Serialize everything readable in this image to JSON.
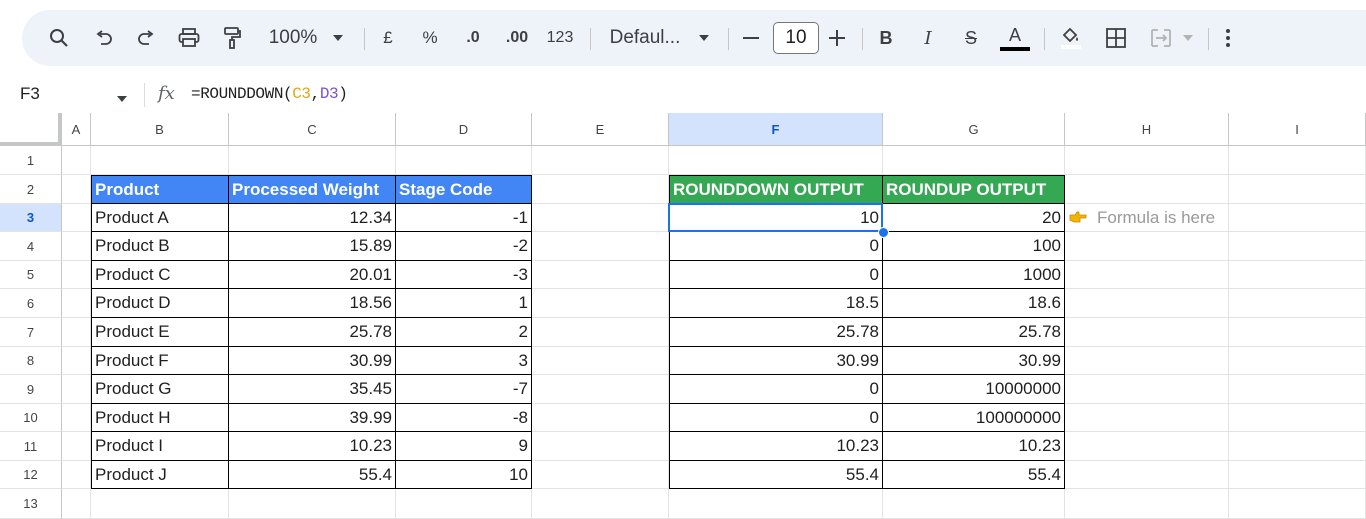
{
  "toolbar": {
    "zoom": "100%",
    "currency": "£",
    "percent": "%",
    "dec_decrease": ".0",
    "dec_increase": ".00",
    "number_format": "123",
    "font_name": "Defaul...",
    "font_size": "10",
    "bold": "B",
    "italic": "I",
    "strike": "S",
    "text_color": "A"
  },
  "formula_bar": {
    "name_box": "F3",
    "fx": "fx",
    "formula_prefix": "=ROUNDDOWN(",
    "ref1": "C3",
    "comma": ",",
    "ref2": "D3",
    "formula_suffix": ")"
  },
  "columns": [
    "A",
    "B",
    "C",
    "D",
    "E",
    "F",
    "G",
    "H",
    "I"
  ],
  "rows": [
    "1",
    "2",
    "3",
    "4",
    "5",
    "6",
    "7",
    "8",
    "9",
    "10",
    "11",
    "12",
    "13"
  ],
  "table1": {
    "headers": [
      "Product",
      "Processed Weight",
      "Stage Code"
    ],
    "rows": [
      [
        "Product A",
        "12.34",
        "-1"
      ],
      [
        "Product B",
        "15.89",
        "-2"
      ],
      [
        "Product C",
        "20.01",
        "-3"
      ],
      [
        "Product D",
        "18.56",
        "1"
      ],
      [
        "Product E",
        "25.78",
        "2"
      ],
      [
        "Product F",
        "30.99",
        "3"
      ],
      [
        "Product G",
        "35.45",
        "-7"
      ],
      [
        "Product H",
        "39.99",
        "-8"
      ],
      [
        "Product I",
        "10.23",
        "9"
      ],
      [
        "Product J",
        "55.4",
        "10"
      ]
    ]
  },
  "table2": {
    "headers": [
      "ROUNDDOWN OUTPUT",
      "ROUNDUP OUTPUT"
    ],
    "rows": [
      [
        "10",
        "20"
      ],
      [
        "0",
        "100"
      ],
      [
        "0",
        "1000"
      ],
      [
        "18.5",
        "18.6"
      ],
      [
        "25.78",
        "25.78"
      ],
      [
        "30.99",
        "30.99"
      ],
      [
        "0",
        "10000000"
      ],
      [
        "0",
        "100000000"
      ],
      [
        "10.23",
        "10.23"
      ],
      [
        "55.4",
        "55.4"
      ]
    ]
  },
  "note": {
    "icon": "pointing-hand-icon",
    "text": "Formula is here"
  },
  "colors": {
    "blue_header": "#4285f4",
    "green_header": "#34a853",
    "selection": "#1a73e8"
  }
}
